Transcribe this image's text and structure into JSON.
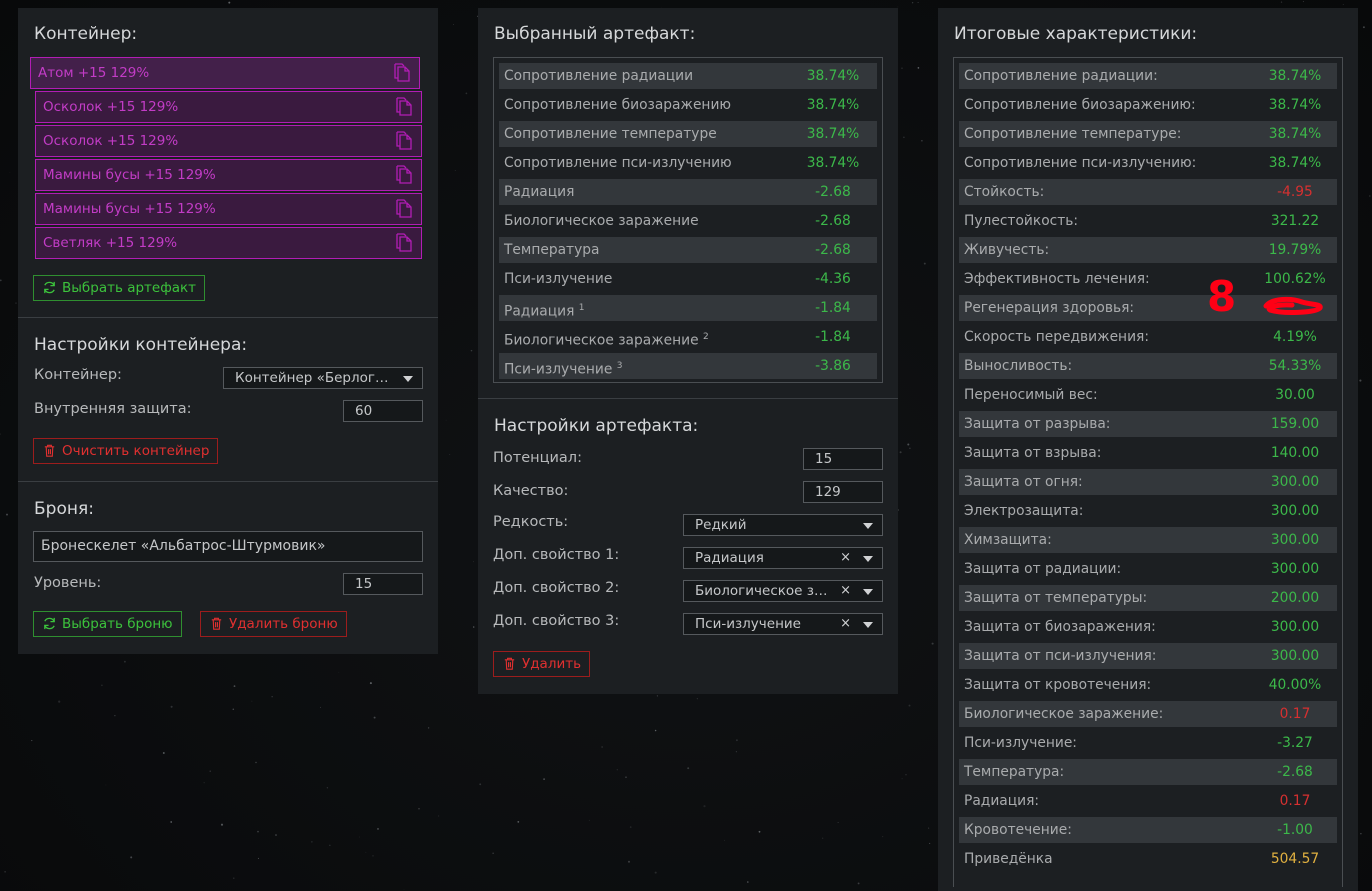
{
  "container_panel": {
    "title": "Контейнер:",
    "artifacts": [
      "Атом +15 129%",
      "Осколок +15 129%",
      "Осколок +15 129%",
      "Мамины бусы +15 129%",
      "Мамины бусы +15 129%",
      "Светляк +15 129%"
    ],
    "select_artifact_button": "Выбрать артефакт",
    "settings_title": "Настройки контейнера:",
    "container_label": "Контейнер:",
    "container_value": "Контейнер «Берлога…",
    "inner_protection_label": "Внутренняя защита:",
    "inner_protection_value": "60",
    "clear_button": "Очистить контейнер",
    "armor_title": "Броня:",
    "armor_value": "Бронескелет «Альбатрос-Штурмовик»",
    "level_label": "Уровень:",
    "level_value": "15",
    "select_armor_button": "Выбрать броню",
    "delete_armor_button": "Удалить броню"
  },
  "artifact_panel": {
    "title": "Выбранный артефакт:",
    "stats": [
      {
        "name": "Сопротивление радиации",
        "sup": "",
        "value": "38.74%",
        "color": "green"
      },
      {
        "name": "Сопротивление биозаражению",
        "sup": "",
        "value": "38.74%",
        "color": "green"
      },
      {
        "name": "Сопротивление температуре",
        "sup": "",
        "value": "38.74%",
        "color": "green"
      },
      {
        "name": "Сопротивление пси-излучению",
        "sup": "",
        "value": "38.74%",
        "color": "green"
      },
      {
        "name": "Радиация",
        "sup": "",
        "value": "-2.68",
        "color": "green"
      },
      {
        "name": "Биологическое заражение",
        "sup": "",
        "value": "-2.68",
        "color": "green"
      },
      {
        "name": "Температура",
        "sup": "",
        "value": "-2.68",
        "color": "green"
      },
      {
        "name": "Пси-излучение",
        "sup": "",
        "value": "-4.36",
        "color": "green"
      },
      {
        "name": "Радиация",
        "sup": "1",
        "value": "-1.84",
        "color": "green"
      },
      {
        "name": "Биологическое заражение",
        "sup": "2",
        "value": "-1.84",
        "color": "green"
      },
      {
        "name": "Пси-излучение",
        "sup": "3",
        "value": "-3.86",
        "color": "green"
      }
    ],
    "settings_title": "Настройки артефакта:",
    "potential_label": "Потенциал:",
    "potential_value": "15",
    "quality_label": "Качество:",
    "quality_value": "129",
    "rarity_label": "Редкость:",
    "rarity_value": "Редкий",
    "extra1_label": "Доп. свойство 1:",
    "extra1_value": "Радиация",
    "extra2_label": "Доп. свойство 2:",
    "extra2_value": "Биологическое за…",
    "extra3_label": "Доп. свойство 3:",
    "extra3_value": "Пси-излучение",
    "clear_symbol": "×",
    "delete_button": "Удалить"
  },
  "totals_panel": {
    "title": "Итоговые характеристики:",
    "stats": [
      {
        "name": "Сопротивление радиации:",
        "value": "38.74%",
        "color": "green"
      },
      {
        "name": "Сопротивление биозаражению:",
        "value": "38.74%",
        "color": "green"
      },
      {
        "name": "Сопротивление температуре:",
        "value": "38.74%",
        "color": "green"
      },
      {
        "name": "Сопротивление пси-излучению:",
        "value": "38.74%",
        "color": "green"
      },
      {
        "name": "Стойкость:",
        "value": "-4.95",
        "color": "red"
      },
      {
        "name": "Пулестойкость:",
        "value": "321.22",
        "color": "green"
      },
      {
        "name": "Живучесть:",
        "value": "19.79%",
        "color": "green"
      },
      {
        "name": "Эффективность лечения:",
        "value": "100.62%",
        "color": "green"
      },
      {
        "name": "Регенерация здоровья:",
        "value": "",
        "color": "green"
      },
      {
        "name": "Скорость передвижения:",
        "value": "4.19%",
        "color": "green"
      },
      {
        "name": "Выносливость:",
        "value": "54.33%",
        "color": "green"
      },
      {
        "name": "Переносимый вес:",
        "value": "30.00",
        "color": "green"
      },
      {
        "name": "Защита от разрыва:",
        "value": "159.00",
        "color": "green"
      },
      {
        "name": "Защита от взрыва:",
        "value": "140.00",
        "color": "green"
      },
      {
        "name": "Защита от огня:",
        "value": "300.00",
        "color": "green"
      },
      {
        "name": "Электрозащита:",
        "value": "300.00",
        "color": "green"
      },
      {
        "name": "Химзащита:",
        "value": "300.00",
        "color": "green"
      },
      {
        "name": "Защита от радиации:",
        "value": "300.00",
        "color": "green"
      },
      {
        "name": "Защита от температуры:",
        "value": "200.00",
        "color": "green"
      },
      {
        "name": "Защита от биозаражения:",
        "value": "300.00",
        "color": "green"
      },
      {
        "name": "Защита от пси-излучения:",
        "value": "300.00",
        "color": "green"
      },
      {
        "name": "Защита от кровотечения:",
        "value": "40.00%",
        "color": "green"
      },
      {
        "name": "Биологическое заражение:",
        "value": "0.17",
        "color": "red"
      },
      {
        "name": "Пси-излучение:",
        "value": "-3.27",
        "color": "green"
      },
      {
        "name": "Температура:",
        "value": "-2.68",
        "color": "green"
      },
      {
        "name": "Радиация:",
        "value": "0.17",
        "color": "red"
      },
      {
        "name": "Кровотечение:",
        "value": "-1.00",
        "color": "green"
      },
      {
        "name": "Приведёнка",
        "value": "504.57",
        "color": "gold"
      }
    ],
    "annotation_text": "8"
  }
}
